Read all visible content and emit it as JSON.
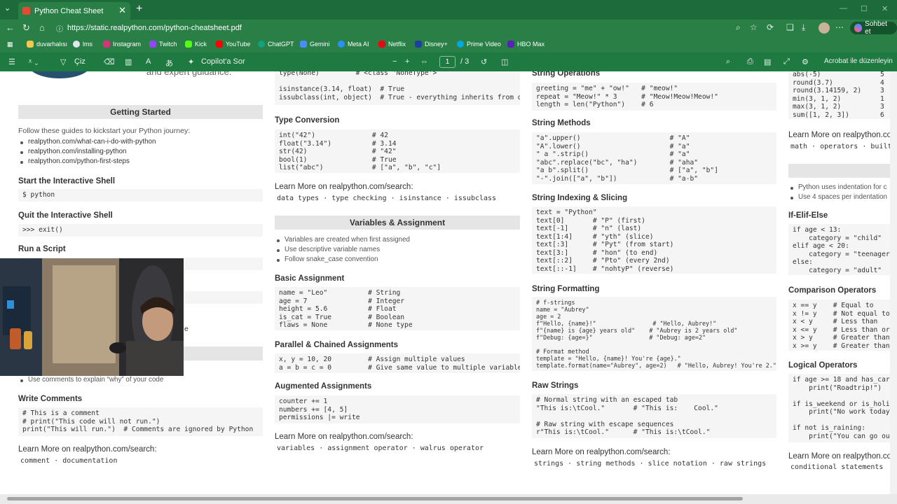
{
  "browser": {
    "tab_title": "Python Cheat Sheet",
    "tab_close": "✕",
    "new_tab": "+",
    "tab_list": "⌄",
    "url": "https://static.realpython.com/python-cheatsheet.pdf",
    "copilot_label": "Sohbet et",
    "win_minimize": "—",
    "win_maximize": "☐",
    "win_close": "✕",
    "bookmarks": [
      {
        "label": "duvarhalısı",
        "color": "#f2c94c"
      },
      {
        "label": "lms",
        "color": "#dfe6ee"
      },
      {
        "label": "Instagram",
        "color": "#d6337a"
      },
      {
        "label": "Twitch",
        "color": "#9147ff"
      },
      {
        "label": "Kick",
        "color": "#53fc18"
      },
      {
        "label": "ChatGPT",
        "color": "#10a37f"
      },
      {
        "label": "Gemini",
        "color": "#4a8cff"
      },
      {
        "label": "Meta AI",
        "color": "#2a8fff"
      },
      {
        "label": "Netflix",
        "color": "#e50914"
      },
      {
        "label": "Disney+",
        "color": "#1c3fa0"
      },
      {
        "label": "Prime Video",
        "color": "#00a8e1"
      },
      {
        "label": "HBO Max",
        "color": "#5822b4"
      }
    ]
  },
  "pdf_toolbar": {
    "draw_label": "Çiz",
    "copilot_label": "Copilot'a Sor",
    "minus": "−",
    "plus": "+",
    "page_current": "1",
    "page_total": "/ 3",
    "acrobat_label": "Acrobat ile düzenleyin"
  },
  "col1": {
    "tagline": "and expert guidance.",
    "getting_started": "Getting Started",
    "intro": "Follow these guides to kickstart your Python journey:",
    "links": [
      "realpython.com/what-can-i-do-with-python",
      "realpython.com/installing-python",
      "realpython.com/python-first-steps"
    ],
    "shell_heading": "Start the Interactive Shell",
    "shell_code": "$ python",
    "quit_heading": "Quit the Interactive Shell",
    "quit_code": ">>> exit()",
    "script_heading": "Run a Script",
    "partial_e": "e",
    "comments_bullet": "Use comments to explain “why” of your code",
    "write_heading": "Write Comments",
    "write_code": "# This is a comment\n# print(\"This code will not run.\")\nprint(\"This will run.\")  # Comments are ignored by Python",
    "learn": "Learn More on realpython.com/search:",
    "tags": "comment · documentation"
  },
  "col2": {
    "top_code": "type(None)         # <class 'NoneType'>\n\nisinstance(3.14, float)  # True\nissubclass(int, object)  # True - everything inherits from object",
    "type_conv_heading": "Type Conversion",
    "type_conv_code": "int(\"42\")              # 42\nfloat(\"3.14\")          # 3.14\nstr(42)                # \"42\"\nbool(1)                # True\nlist(\"abc\")            # [\"a\", \"b\", \"c\"]",
    "learn1": "Learn More on realpython.com/search:",
    "tags1": "data types · type checking · isinstance · issubclass",
    "vars_band": "Variables & Assignment",
    "vars_bullets": [
      "Variables are created when first assigned",
      "Use descriptive variable names",
      "Follow snake_case convention"
    ],
    "basic_heading": "Basic Assignment",
    "basic_code": "name = \"Leo\"          # String\nage = 7               # Integer\nheight = 5.6          # Float\nis_cat = True         # Boolean\nflaws = None          # None type",
    "parallel_heading": "Parallel & Chained Assignments",
    "parallel_code": "x, y = 10, 20         # Assign multiple values\na = b = c = 0         # Give same value to multiple variables",
    "aug_heading": "Augmented Assignments",
    "aug_code": "counter += 1\nnumbers += [4, 5]\npermissions |= write",
    "learn2": "Learn More on realpython.com/search:",
    "tags2": "variables · assignment operator · walrus operator"
  },
  "col3": {
    "strops_heading": "String Operations",
    "strops_code": "greeting = \"me\" + \"ow!\"   # \"meow!\"\nrepeat = \"Meow!\" * 3      # \"Meow!Meow!Meow!\"\nlength = len(\"Python\")    # 6",
    "methods_heading": "String Methods",
    "methods_code": "\"a\".upper()                      # \"A\"\n\"A\".lower()                      # \"a\"\n\" a \".strip()                    # \"a\"\n\"abc\".replace(\"bc\", \"ha\")        # \"aha\"\n\"a b\".split()                    # [\"a\", \"b\"]\n\"-\".join([\"a\", \"b\"])             # \"a-b\"",
    "slicing_heading": "String Indexing & Slicing",
    "slicing_code": "text = \"Python\"\ntext[0]       # \"P\" (first)\ntext[-1]      # \"n\" (last)\ntext[1:4]     # \"yth\" (slice)\ntext[:3]      # \"Pyt\" (from start)\ntext[3:]      # \"hon\" (to end)\ntext[::2]     # \"Pto\" (every 2nd)\ntext[::-1]    # \"nohtyP\" (reverse)",
    "format_heading": "String Formatting",
    "format_code": "# f-strings\nname = \"Aubrey\"\nage = 2\nf\"Hello, {name}!\"                # \"Hello, Aubrey!\"\nf\"{name} is {age} years old\"    # \"Aubrey is 2 years old\"\nf\"Debug: {age=}\"                # \"Debug: age=2\"\n\n# Format method\ntemplate = \"Hello, {name}! You're {age}.\"\ntemplate.format(name=\"Aubrey\", age=2)   # \"Hello, Aubrey! You're 2.\"",
    "raw_heading": "Raw Strings",
    "raw_code": "# Normal string with an escaped tab\n\"This is:\\tCool.\"       # \"This is:    Cool.\"\n\n# Raw string with escape sequences\nr\"This is:\\tCool.\"      # \"This is:\\tCool.\"",
    "learn": "Learn More on realpython.com/search:",
    "tags": "strings · string methods · slice notation · raw strings"
  },
  "col4": {
    "top_code": "abs(-5)\nround(3.7)\nround(3.14159, 2)\nmin(3, 1, 2)\nmax(3, 1, 2)\nsum([1, 2, 3])",
    "top_right": "5\n4\n3\n1\n3\n6",
    "learn1": "Learn More on realpython.co",
    "tags1": "math · operators · built",
    "bullets": [
      "Python uses indentation for c",
      "Use 4 spaces per indentation"
    ],
    "ifelif_heading": "If-Elif-Else",
    "ifelif_code": "if age < 13:\n    category = \"child\"\nelif age < 20:\n    category = \"teenager\nelse:\n    category = \"adult\"",
    "comparison_heading": "Comparison Operators",
    "comparison_code": "x == y    # Equal to\nx != y    # Not equal to\nx < y     # Less than\nx <= y    # Less than or\nx > y     # Greater than\nx >= y    # Greater than",
    "logical_heading": "Logical Operators",
    "logical_code": "if age >= 18 and has_car\n    print(\"Roadtrip!\")\n\nif is_weekend or is_holi\n    print(\"No work today\n\nif not is_raining:\n    print(\"You can go ou",
    "learn2": "Learn More on realpython.co",
    "tags2": "conditional statements"
  }
}
